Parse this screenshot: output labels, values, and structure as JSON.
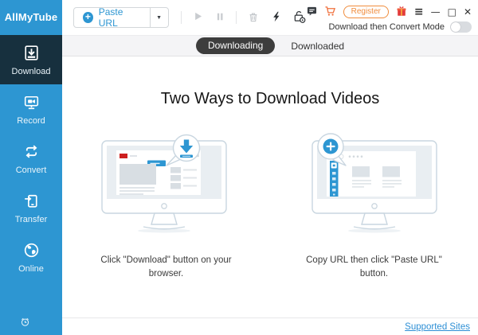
{
  "window": {
    "title": "AllMyTube"
  },
  "colors": {
    "sidebar_blue": "#2d96d2",
    "sidebar_active_dark": "#17303e",
    "accent_blue": "#2d96d2",
    "register_orange": "#f08c3c",
    "gift_red": "#e23b3b",
    "tab_pill_dark": "#3d3d3d",
    "link_blue": "#2d8fd5"
  },
  "sidebar": {
    "brand": "AllMyTube",
    "items": [
      {
        "label": "Download",
        "active": true
      },
      {
        "label": "Record",
        "active": false
      },
      {
        "label": "Convert",
        "active": false
      },
      {
        "label": "Transfer",
        "active": false
      },
      {
        "label": "Online",
        "active": false
      }
    ]
  },
  "toolbar": {
    "paste_url_label": "Paste URL",
    "register_label": "Register",
    "mode_label": "Download then Convert Mode",
    "mode_enabled": false
  },
  "glyphs": {
    "plus": "+",
    "caret_down": "▼",
    "menu": "≡",
    "minimize": "—",
    "maximize": "□",
    "close": "✕"
  },
  "tabs": [
    {
      "label": "Downloading",
      "active": true
    },
    {
      "label": "Downloaded",
      "active": false
    }
  ],
  "content": {
    "heading": "Two Ways to Download Videos",
    "methods": [
      {
        "caption": "Click \"Download\" button on your browser."
      },
      {
        "caption": "Copy URL then click \"Paste URL\" button."
      }
    ]
  },
  "footer": {
    "supported_sites_label": "Supported Sites"
  }
}
